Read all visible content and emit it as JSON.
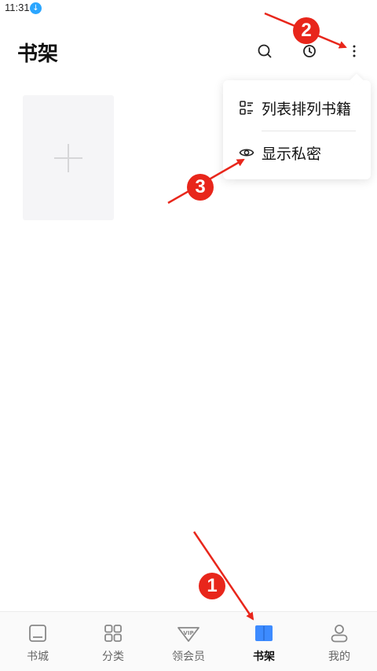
{
  "status_bar": {
    "time": "11:31"
  },
  "header": {
    "title": "书架"
  },
  "menu": {
    "items": [
      {
        "label": "列表排列书籍"
      },
      {
        "label": "显示私密"
      }
    ]
  },
  "tabs": [
    {
      "label": "书城",
      "active": false
    },
    {
      "label": "分类",
      "active": false
    },
    {
      "label": "领会员",
      "active": false
    },
    {
      "label": "书架",
      "active": true
    },
    {
      "label": "我的",
      "active": false
    }
  ],
  "annotations": {
    "badges": [
      "1",
      "2",
      "3"
    ]
  },
  "colors": {
    "accent": "#3d8bff",
    "annotation": "#e8261b"
  }
}
